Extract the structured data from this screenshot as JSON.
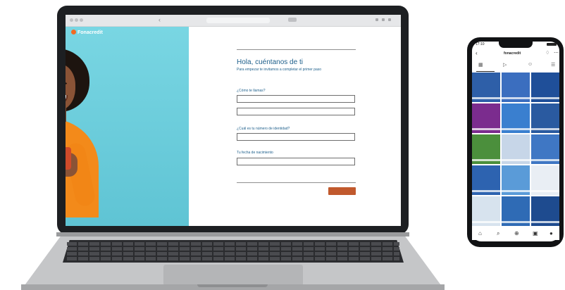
{
  "web_form": {
    "brand": "Fonacredit",
    "title": "Hola, cuéntanos de ti",
    "subtitle": "Para empezar te invitamos a completar el primer paso",
    "fields": [
      {
        "label": "¿Cómo te llamas?"
      },
      {
        "label": "¿Cuál es tu número de identidad?"
      },
      {
        "label": "Tu fecha de nacimiento"
      }
    ],
    "submit_label": ""
  },
  "phone": {
    "status_time": "17:10",
    "username": "fonacredit",
    "icons": {
      "back": "back-arrow-icon",
      "bell": "bell-icon",
      "more": "more-icon",
      "tabs": [
        "grid-icon",
        "reels-icon",
        "tagged-icon",
        "guides-icon"
      ],
      "nav": [
        "home-icon",
        "search-icon",
        "add-icon",
        "shop-icon",
        "profile-icon"
      ]
    },
    "tile_colors": [
      "#2e5fa8",
      "#3b6ebf",
      "#1f4f99",
      "#7b2c8e",
      "#3a7fcf",
      "#2a5aa0",
      "#4b8f3c",
      "#c7d6e8",
      "#3f77c4",
      "#2d63b0",
      "#5a9bd8",
      "#e9eef4",
      "#d7e3ee",
      "#2f6bb5",
      "#1e4b8f"
    ]
  }
}
